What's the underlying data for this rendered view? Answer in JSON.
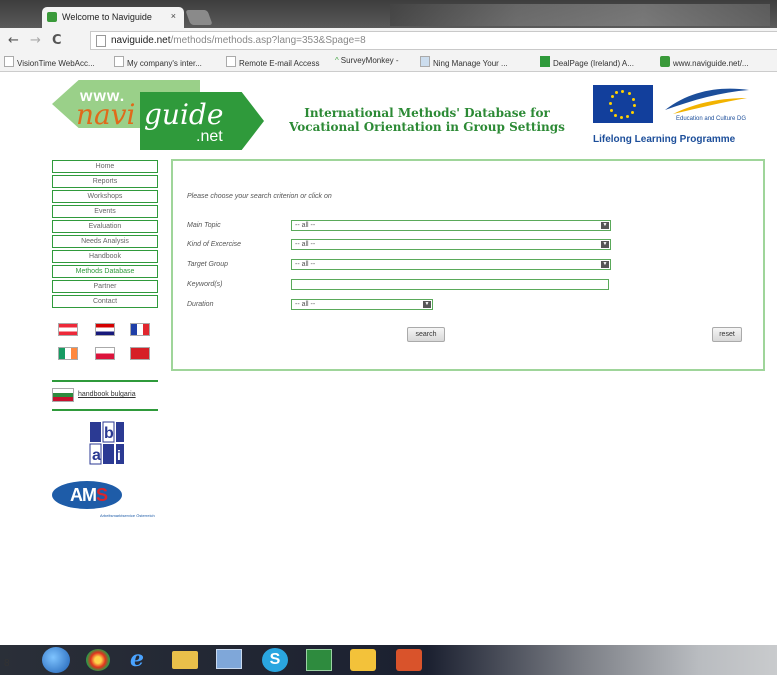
{
  "browser": {
    "tab_title": "Welcome to Naviguide",
    "tab_close": "×",
    "url_host": "naviguide.net",
    "url_path": "/methods/methods.asp?lang=353&Spage=8",
    "back": "←",
    "forward": "→",
    "reload": "C",
    "bookmarks": [
      {
        "label": "VisionTime WebAcc..."
      },
      {
        "label": "My company's inter..."
      },
      {
        "label": "Remote E-mail Access"
      },
      {
        "label": "SurveyMonkey -"
      },
      {
        "label": "Ning Manage Your ..."
      },
      {
        "label": "DealPage (Ireland) A..."
      },
      {
        "label": "www.naviguide.net/..."
      }
    ]
  },
  "header": {
    "logo_www": "www.",
    "logo_navi": "navi",
    "logo_guide": "guide",
    "logo_net": ".net",
    "title_line1": "International Methods' Database for",
    "title_line2": "Vocational Orientation in Group Settings",
    "eac_label": "Education and Culture DG",
    "llp_label": "Lifelong Learning Programme"
  },
  "nav": {
    "items": [
      {
        "label": "Home"
      },
      {
        "label": "Reports"
      },
      {
        "label": "Workshops"
      },
      {
        "label": "Events"
      },
      {
        "label": "Evaluation"
      },
      {
        "label": "Needs Analysis"
      },
      {
        "label": "Handbook"
      },
      {
        "label": "Methods Database"
      },
      {
        "label": "Partner"
      },
      {
        "label": "Contact"
      }
    ],
    "handbook_link": "handbook bulgaria"
  },
  "sponsors": {
    "ams_a": "AM",
    "ams_s": "S",
    "ams_sub": "Arbeitsmarktservice Österreich"
  },
  "form": {
    "prompt": "Please choose your search criterion or click on",
    "main_topic_label": "Main Topic",
    "main_topic_value": "-- all --",
    "kind_label": "Kind of Excercise",
    "kind_value": "-- all --",
    "target_label": "Target Group",
    "target_value": "-- all --",
    "keyword_label": "Keyword(s)",
    "keyword_value": "",
    "duration_label": "Duration",
    "duration_value": "-- all --",
    "search_label": "search",
    "reset_label": "reset"
  },
  "colors": {
    "brand_green": "#2f9a3b",
    "light_green": "#9ad089",
    "orange": "#e06a1a",
    "eu_blue": "#123f9c"
  }
}
